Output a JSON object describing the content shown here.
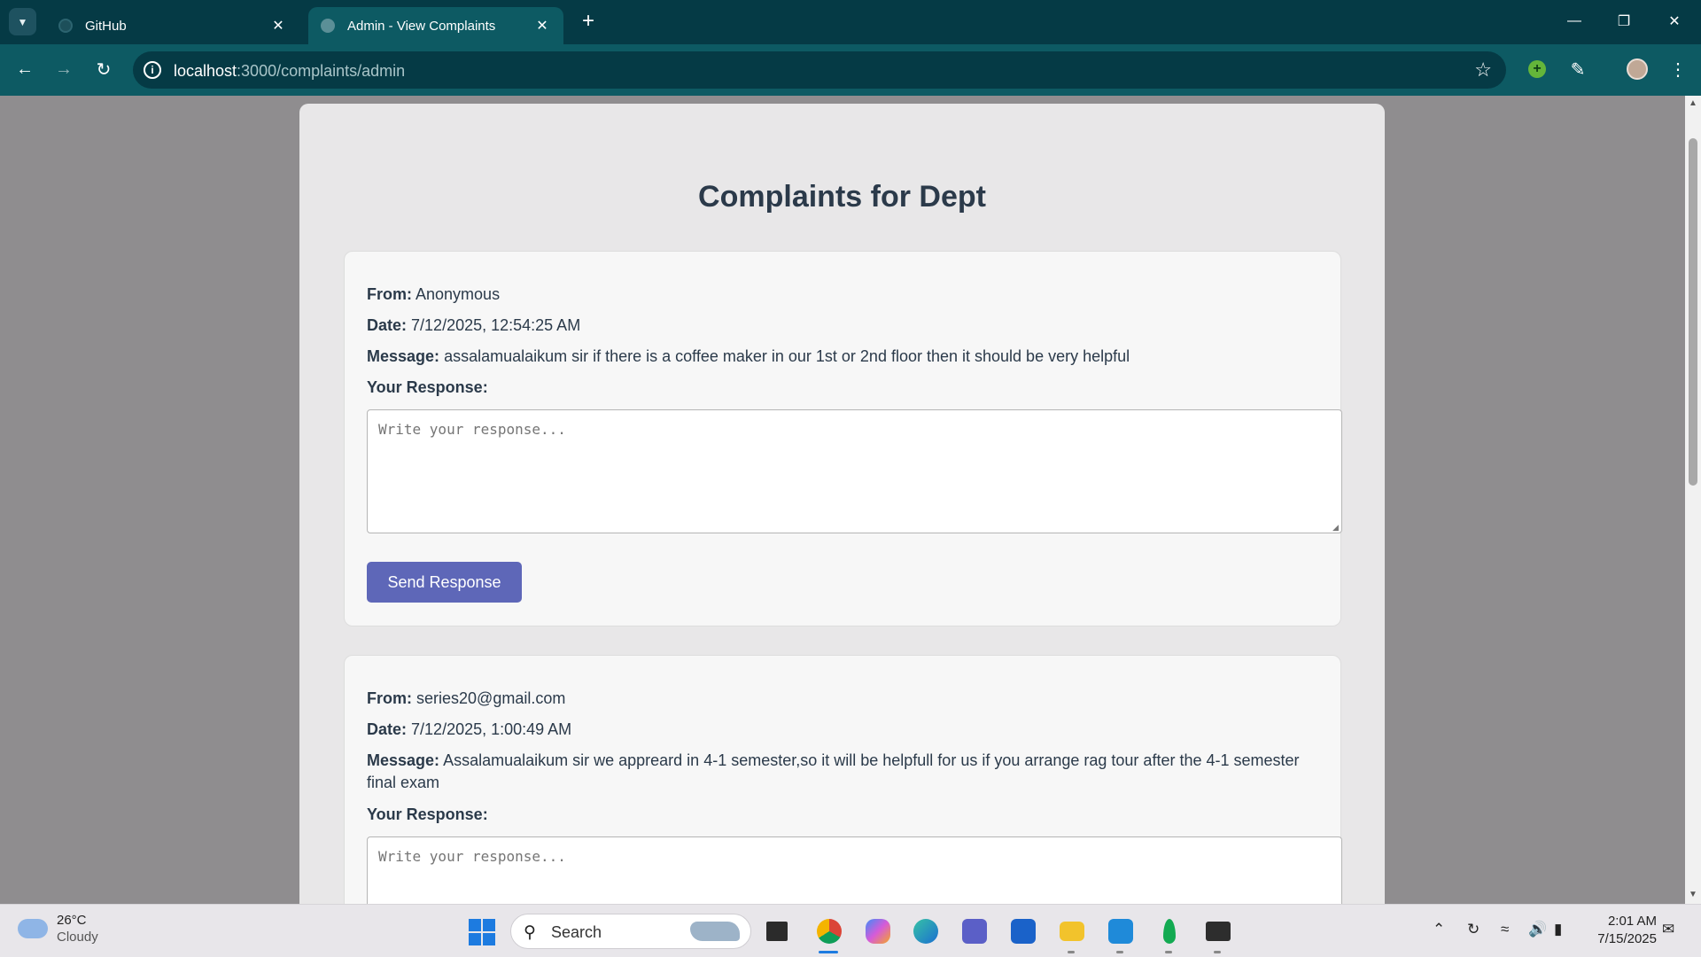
{
  "browser": {
    "tabs": [
      {
        "title": "GitHub",
        "active": false
      },
      {
        "title": "Admin - View Complaints",
        "active": true
      }
    ],
    "url_host": "localhost",
    "url_rest": ":3000/complaints/admin"
  },
  "page": {
    "title": "Complaints for Dept",
    "complaints": [
      {
        "from_label": "From:",
        "from": "Anonymous",
        "date_label": "Date:",
        "date": "7/12/2025, 12:54:25 AM",
        "message_label": "Message:",
        "message": "assalamualaikum sir if there is a coffee maker in our 1st or 2nd floor then it should be very helpful",
        "response_label": "Your Response:",
        "response_placeholder": "Write your response...",
        "send_label": "Send Response"
      },
      {
        "from_label": "From:",
        "from": "series20@gmail.com",
        "date_label": "Date:",
        "date": "7/12/2025, 1:00:49 AM",
        "message_label": "Message:",
        "message": "Assalamualaikum sir we appreard in 4-1 semester,so it will be helpfull for us if you arrange rag tour after the 4-1 semester final exam",
        "response_label": "Your Response:",
        "response_placeholder": "Write your response..."
      }
    ]
  },
  "taskbar": {
    "weather_temp": "26°C",
    "weather_cond": "Cloudy",
    "search_label": "Search",
    "time": "2:01 AM",
    "date": "7/15/2025",
    "apps": [
      "file-manager-icon",
      "chrome-icon",
      "copilot-icon",
      "edge-icon",
      "teams-icon",
      "store-icon",
      "file-explorer-icon",
      "vscode-icon",
      "mongodb-compass-icon",
      "terminal-icon"
    ]
  },
  "colors": {
    "tab_bar": "#053a45",
    "toolbar": "#0d5a63",
    "page_bg": "#8f8d8f",
    "card_bg": "#f7f7f7",
    "button": "#5e67b8",
    "heading": "#2b3a4a"
  }
}
